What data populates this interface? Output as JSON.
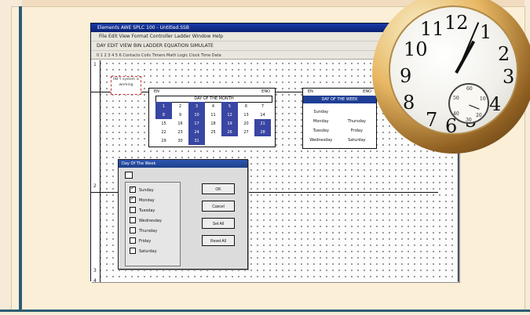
{
  "app": {
    "title": "Elements AWE SPLC 100 - Untitled.SSB",
    "menu": "File  Edit  View  Format  Controller  Ladder  Window  Help",
    "toolbar": "DAY  EDIT  VIEW  BIN  LADDER  EQUATION  SIMULATE",
    "toolbar2": "0 1 2 3 4 5 6   Contacts  Coils  Timers  Math  Logic  Clock  Time  Data  ",
    "rail_numbers": [
      "1",
      "2",
      "3",
      "4"
    ],
    "contact_note": "HB Y system is working"
  },
  "month_block": {
    "left_label": "EN",
    "right_label": "ENO",
    "title": "DAY OF THE MONTH",
    "days": [
      [
        "1",
        "2",
        "3",
        "4",
        "5",
        "6",
        "7"
      ],
      [
        "8",
        "9",
        "10",
        "11",
        "12",
        "13",
        "14"
      ],
      [
        "15",
        "16",
        "17",
        "18",
        "19",
        "20",
        "21"
      ],
      [
        "22",
        "23",
        "24",
        "25",
        "26",
        "27",
        "28"
      ],
      [
        "29",
        "30",
        "31",
        "",
        "",
        "",
        ""
      ]
    ],
    "selected": [
      "1",
      "3",
      "5",
      "8",
      "10",
      "12",
      "17",
      "19",
      "21",
      "24",
      "26",
      "28",
      "31"
    ]
  },
  "week_block": {
    "left_label": "EN",
    "right_label": "ENO",
    "title": "DAY OF THE WEEK",
    "rows": [
      [
        "Sunday",
        ""
      ],
      [
        "Monday",
        "Thursday"
      ],
      [
        "Tuesday",
        "Friday"
      ],
      [
        "Wednesday",
        "Saturday"
      ]
    ]
  },
  "dialog": {
    "title": "Day Of The Week",
    "days": [
      "Sunday",
      "Monday",
      "Tuesday",
      "Wednesday",
      "Thursday",
      "Friday",
      "Saturday"
    ],
    "checked": [
      "Sunday",
      "Monday"
    ],
    "ok": "OK",
    "cancel": "Cancel",
    "set_all": "Set All",
    "reset_all": "Reset All"
  },
  "clock": {
    "numbers": [
      "12",
      "1",
      "2",
      "3",
      "4",
      "5",
      "6",
      "7",
      "8",
      "9",
      "10",
      "11"
    ],
    "small_numbers": [
      "60",
      "10",
      "20",
      "30",
      "40",
      "50"
    ]
  }
}
